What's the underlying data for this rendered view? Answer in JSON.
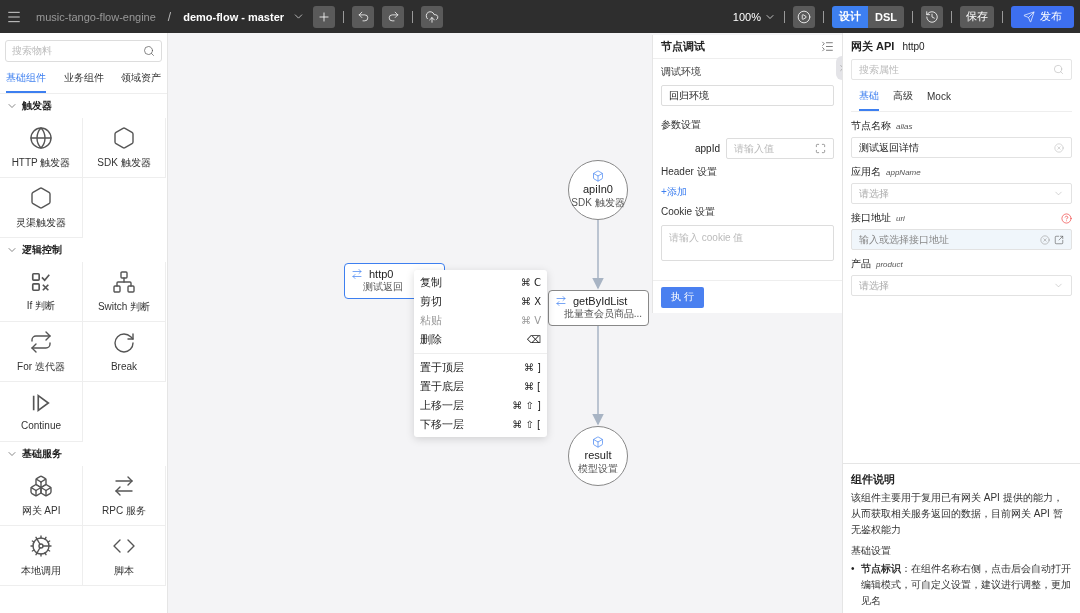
{
  "topbar": {
    "project": "music-tango-flow-engine",
    "separator": "/",
    "flow": "demo-flow - master",
    "zoom": "100%",
    "mode_tabs": [
      {
        "label": "设计",
        "selected": true
      },
      {
        "label": "DSL",
        "selected": false
      }
    ],
    "save": "保存",
    "publish": "发布"
  },
  "sidebar": {
    "search": {
      "placeholder": "搜索物料"
    },
    "tabs": [
      {
        "label": "基础组件",
        "selected": true
      },
      {
        "label": "业务组件",
        "selected": false
      },
      {
        "label": "领域资产",
        "selected": false
      }
    ],
    "sections": [
      {
        "title": "触发器",
        "expanded": true,
        "items": [
          {
            "label": "HTTP 触发器",
            "kind": "http"
          },
          {
            "label": "SDK 触发器",
            "kind": "sdk"
          },
          {
            "label": "灵渠触发器",
            "kind": "sdk"
          }
        ]
      },
      {
        "title": "逻辑控制",
        "expanded": true,
        "items": [
          {
            "label": "If 判断",
            "kind": "if"
          },
          {
            "label": "Switch 判断",
            "kind": "switch"
          },
          {
            "label": "For 迭代器",
            "kind": "for"
          },
          {
            "label": "Break",
            "kind": "break"
          },
          {
            "label": "Continue",
            "kind": "continue"
          }
        ]
      },
      {
        "title": "基础服务",
        "expanded": true,
        "items": [
          {
            "label": "网关 API",
            "kind": "gateway"
          },
          {
            "label": "RPC 服务",
            "kind": "rpc"
          },
          {
            "label": "本地调用",
            "kind": "local"
          },
          {
            "label": "脚本",
            "kind": "script"
          }
        ]
      }
    ]
  },
  "canvas": {
    "nodes": [
      {
        "kind": "circle",
        "title": "apiIn0",
        "subtitle": "SDK 触发器",
        "selected": false
      },
      {
        "kind": "card",
        "title": "getByIdList",
        "subtitle": "批量查会员商品...",
        "selected": false
      },
      {
        "kind": "circle",
        "title": "result",
        "subtitle": "模型设置",
        "selected": false
      },
      {
        "kind": "card",
        "title": "http0",
        "subtitle": "测试返回",
        "selected": true
      }
    ],
    "context_menu": {
      "groups": [
        [
          {
            "label": "复制",
            "shortcut": "⌘ C",
            "disabled": false
          },
          {
            "label": "剪切",
            "shortcut": "⌘ X",
            "disabled": false
          },
          {
            "label": "粘贴",
            "shortcut": "⌘ V",
            "disabled": true
          },
          {
            "label": "删除",
            "shortcut": "⌫",
            "disabled": false
          }
        ],
        [
          {
            "label": "置于顶层",
            "shortcut": "⌘ ]",
            "disabled": false
          },
          {
            "label": "置于底层",
            "shortcut": "⌘ [",
            "disabled": false
          },
          {
            "label": "上移一层",
            "shortcut": "⌘ ⇧ ]",
            "disabled": false
          },
          {
            "label": "下移一层",
            "shortcut": "⌘ ⇧ [",
            "disabled": false
          }
        ]
      ]
    }
  },
  "debug_panel": {
    "title": "节点调试",
    "env": {
      "label": "调试环境",
      "value": "回归环境"
    },
    "params": {
      "title": "参数设置",
      "fields": [
        {
          "name": "appId",
          "placeholder": "请输入值"
        }
      ]
    },
    "header": {
      "title": "Header 设置",
      "add": "+添加"
    },
    "cookie": {
      "title": "Cookie 设置",
      "placeholder": "请输入 cookie 值"
    },
    "run": "执 行"
  },
  "properties": {
    "title": "网关 API",
    "node": "http0",
    "search": {
      "placeholder": "搜索属性"
    },
    "tabs": [
      {
        "label": "基础",
        "selected": true
      },
      {
        "label": "高级",
        "selected": false
      },
      {
        "label": "Mock",
        "selected": false
      }
    ],
    "fields": [
      {
        "label": "节点名称",
        "key": "alias",
        "kind": "text",
        "value": "测试返回详情"
      },
      {
        "label": "应用名",
        "key": "appName",
        "kind": "select",
        "placeholder": "请选择"
      },
      {
        "label": "接口地址",
        "key": "uri",
        "kind": "link",
        "placeholder": "输入或选择接口地址"
      },
      {
        "label": "产品",
        "key": "product",
        "kind": "select",
        "placeholder": "请选择"
      }
    ],
    "help": {
      "title": "组件说明",
      "text": "该组件主要用于复用已有网关 API 提供的能力，从而获取相关服务返回的数据，目前网关 API 暂无鉴权能力",
      "subtitle": "基础设置",
      "bullets": [
        {
          "marker": "•",
          "text": "**节点标识**：在组件名称右侧，点击后会自动打开编辑模式，可自定义设置，建议进行调整，更加见名"
        }
      ]
    }
  }
}
